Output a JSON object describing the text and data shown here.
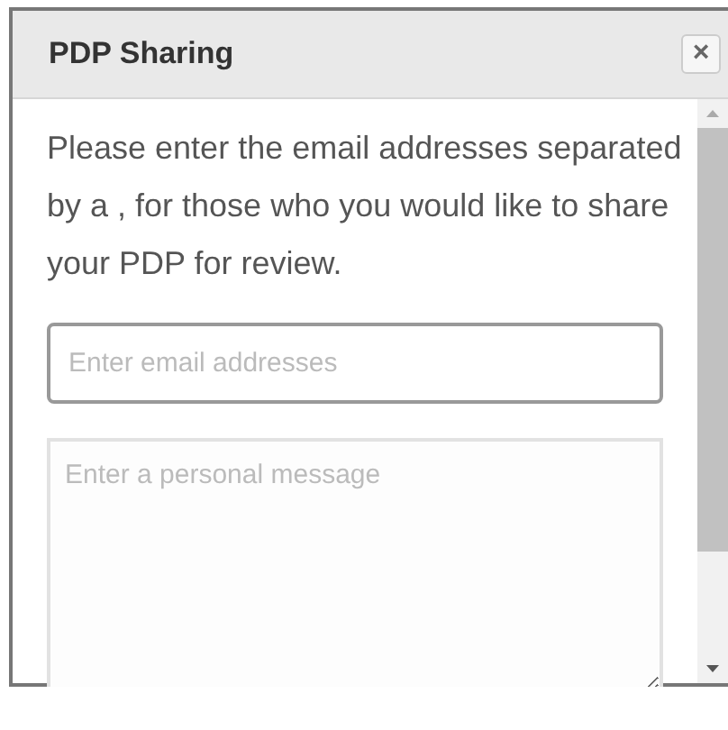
{
  "dialog": {
    "title": "PDP Sharing",
    "close": "×"
  },
  "instructions": "Please enter the email addresses separated by a , for those who you would like to share your PDP for review.",
  "email_field": {
    "placeholder": "Enter email addresses"
  },
  "message_field": {
    "placeholder": "Enter a personal message"
  }
}
